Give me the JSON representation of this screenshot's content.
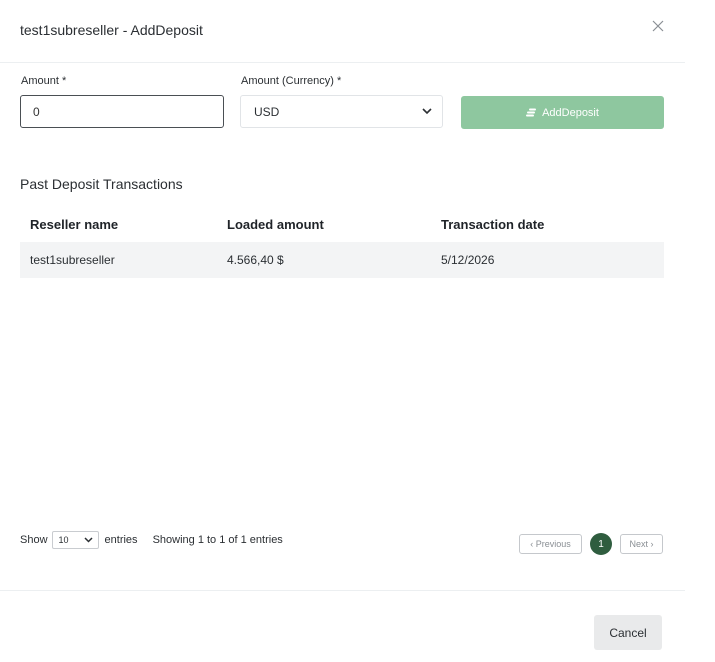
{
  "modal": {
    "title": "test1subreseller - AddDeposit"
  },
  "form": {
    "amount_label": "Amount *",
    "amount_value": "0",
    "currency_label": "Amount (Currency) *",
    "currency_selected": "USD",
    "add_button_label": "AddDeposit",
    "add_button_color": "#8ec79f"
  },
  "transactions": {
    "title": "Past Deposit Transactions",
    "columns": [
      "Reseller name",
      "Loaded amount",
      "Transaction date"
    ],
    "rows": [
      [
        "test1subreseller",
        "4.566,40 $",
        "5/12/2026"
      ]
    ]
  },
  "pagination": {
    "show_label": "Show",
    "page_length": "10",
    "entries_label": "entries",
    "info": "Showing 1 to 1 of 1 entries",
    "previous_label": "Previous",
    "next_label": "Next",
    "current_page": "1",
    "current_page_color": "#2f5d3f"
  },
  "footer": {
    "cancel_label": "Cancel"
  },
  "icons": {
    "close": "close-icon",
    "dropdown": "chevron-down-icon",
    "deposit": "coins-icon"
  }
}
